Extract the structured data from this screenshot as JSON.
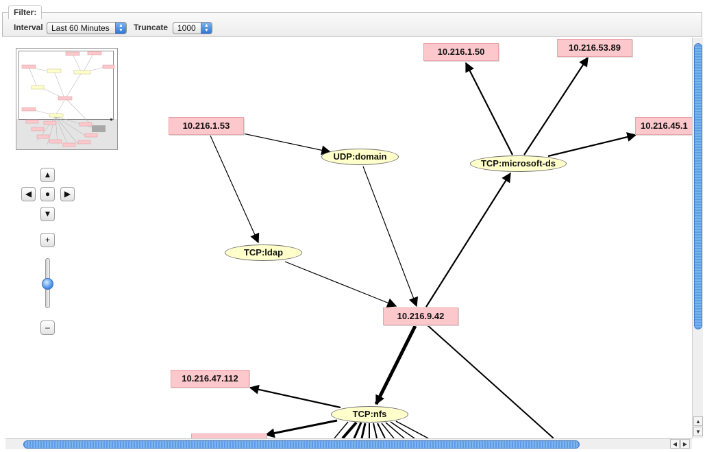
{
  "filter": {
    "title": "Filter:",
    "interval_label": "Interval",
    "interval_value": "Last 60 Minutes",
    "truncate_label": "Truncate",
    "truncate_value": "1000"
  },
  "graph": {
    "hosts": [
      "10.216.1.53",
      "10.216.1.50",
      "10.216.53.89",
      "10.216.45.1",
      "10.216.9.42",
      "10.216.47.112"
    ],
    "services": [
      "UDP:domain",
      "TCP:ldap",
      "TCP:microsoft-ds",
      "TCP:nfs"
    ]
  },
  "nav": {
    "up": "▲",
    "down": "▼",
    "left": "◀",
    "right": "▶",
    "center": "●",
    "zoom_in": "+",
    "zoom_out": "–"
  },
  "scroll": {
    "left": "◀",
    "right": "▶",
    "up": "▲",
    "down": "▼"
  },
  "colors": {
    "host_fill": "#fcc8cc",
    "service_fill": "#ffffcc",
    "scroll_thumb": "#5f9ce6"
  }
}
